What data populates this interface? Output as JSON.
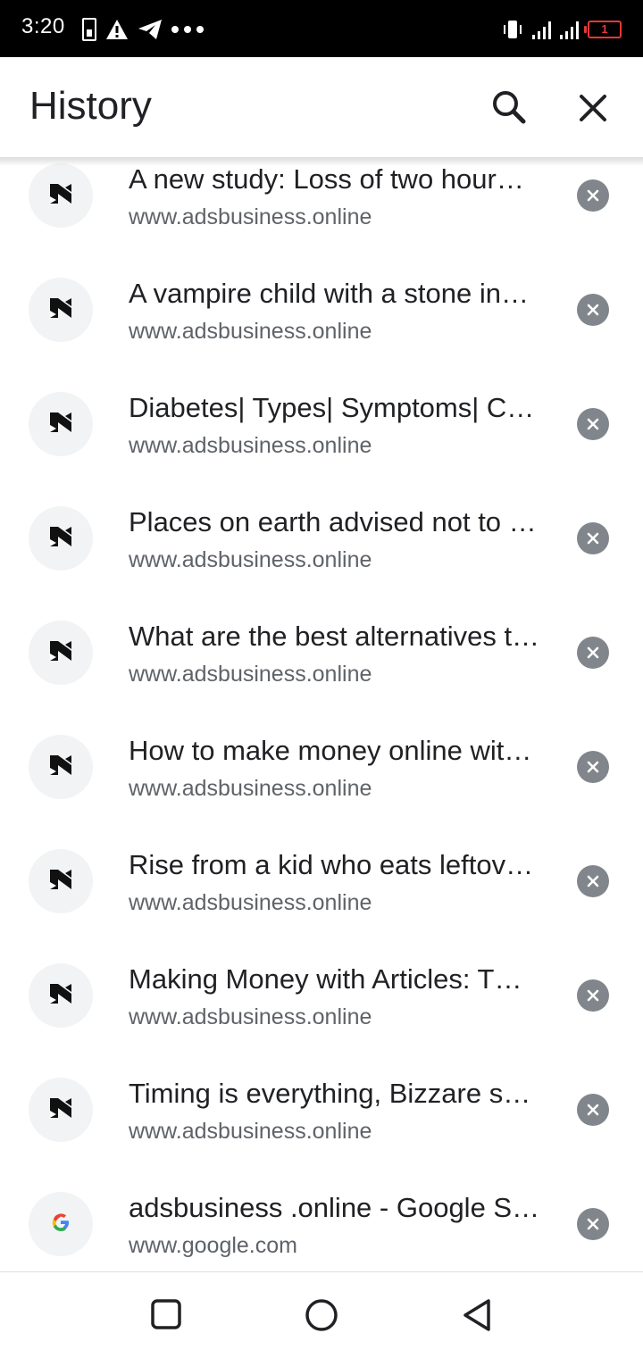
{
  "status_bar": {
    "time": "3:20",
    "battery_level": "1",
    "left_icons": [
      "battery-charging-icon",
      "warning-icon",
      "telegram-icon",
      "more-dots-icon"
    ],
    "right_icons": [
      "vibrate-icon",
      "signal-icon",
      "signal-icon",
      "battery-low-icon"
    ]
  },
  "header": {
    "title": "History",
    "search_icon": "search-icon",
    "close_icon": "close-icon"
  },
  "history": [
    {
      "title": "A new study: Loss of two hour…",
      "url": "www.adsbusiness.online",
      "favicon": "adsbusiness-favicon-icon"
    },
    {
      "title": "A vampire child with a stone in…",
      "url": "www.adsbusiness.online",
      "favicon": "adsbusiness-favicon-icon"
    },
    {
      "title": "Diabetes| Types| Symptoms| C…",
      "url": "www.adsbusiness.online",
      "favicon": "adsbusiness-favicon-icon"
    },
    {
      "title": "Places on earth advised not to …",
      "url": "www.adsbusiness.online",
      "favicon": "adsbusiness-favicon-icon"
    },
    {
      "title": "What are the best alternatives t…",
      "url": "www.adsbusiness.online",
      "favicon": "adsbusiness-favicon-icon"
    },
    {
      "title": "How to make money online wit…",
      "url": "www.adsbusiness.online",
      "favicon": "adsbusiness-favicon-icon"
    },
    {
      "title": "Rise from a kid who eats leftov…",
      "url": "www.adsbusiness.online",
      "favicon": "adsbusiness-favicon-icon"
    },
    {
      "title": "Making Money with Articles: T…",
      "url": "www.adsbusiness.online",
      "favicon": "adsbusiness-favicon-icon"
    },
    {
      "title": "Timing is everything, Bizzare s…",
      "url": "www.adsbusiness.online",
      "favicon": "adsbusiness-favicon-icon"
    },
    {
      "title": "adsbusiness .online - Google S…",
      "url": "www.google.com",
      "favicon": "google-favicon-icon"
    }
  ],
  "nav_bar": {
    "recents": "recents-square-icon",
    "home": "home-circle-icon",
    "back": "back-triangle-icon"
  },
  "colors": {
    "status_bar": "#000000",
    "title_text": "#202124",
    "secondary_text": "#5f6368",
    "remove_button": "#80868b",
    "battery_alert": "#e53935"
  }
}
